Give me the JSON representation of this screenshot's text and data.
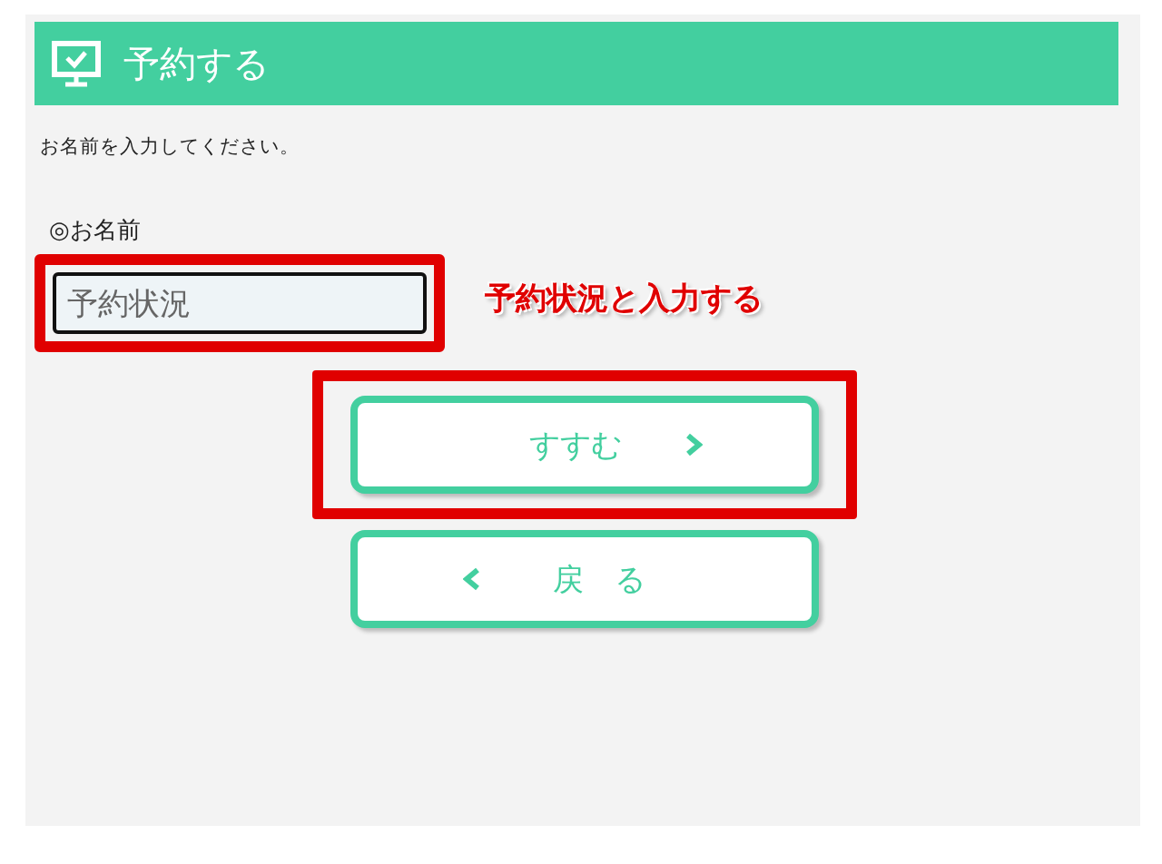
{
  "header": {
    "title": "予約する"
  },
  "instruction": "お名前を入力してください。",
  "name_field": {
    "label": "◎お名前",
    "value": "予約状況",
    "highlighted": true
  },
  "annotation": {
    "text": "予約状況と入力する"
  },
  "buttons": [
    {
      "label": "すすむ",
      "kind": "next",
      "highlighted": true
    },
    {
      "label": "戻　る",
      "kind": "back",
      "highlighted": false
    }
  ]
}
